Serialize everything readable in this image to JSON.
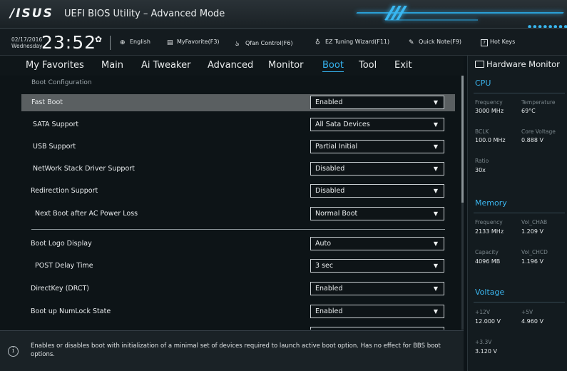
{
  "window": {
    "brand": "/ISUS",
    "title": "UEFI BIOS Utility – Advanced Mode"
  },
  "toolbar": {
    "date": "02/17/2016",
    "day": "Wednesday",
    "time": "23:52",
    "language": "English",
    "myfavorite": "MyFavorite(F3)",
    "qfan": "Qfan Control(F6)",
    "ez_tuning": "EZ Tuning Wizard(F11)",
    "quick_note": "Quick Note(F9)",
    "hot_keys": "Hot Keys"
  },
  "menu": {
    "items": [
      "My Favorites",
      "Main",
      "Ai Tweaker",
      "Advanced",
      "Monitor",
      "Boot",
      "Tool",
      "Exit"
    ],
    "active": "Boot"
  },
  "content": {
    "section": "Boot Configuration",
    "rows": [
      {
        "label": "Fast Boot",
        "value": "Enabled"
      },
      {
        "label": "SATA Support",
        "value": "All Sata Devices"
      },
      {
        "label": "USB Support",
        "value": "Partial Initial"
      },
      {
        "label": "NetWork Stack Driver Support",
        "value": "Disabled"
      },
      {
        "label": "Redirection Support",
        "value": "Disabled"
      },
      {
        "label": "Next Boot after AC Power Loss",
        "value": "Normal Boot"
      },
      {
        "label": "Boot Logo Display",
        "value": "Auto"
      },
      {
        "label": "POST Delay Time",
        "value": "3 sec"
      },
      {
        "label": "DirectKey (DRCT)",
        "value": "Enabled"
      },
      {
        "label": "Boot up NumLock State",
        "value": "Enabled"
      }
    ]
  },
  "help": {
    "text": "Enables or disables boot with initialization of a minimal set of devices required to launch active boot option. Has no effect for BBS boot options."
  },
  "hardware_monitor": {
    "title": "Hardware Monitor",
    "cpu": {
      "heading": "CPU",
      "frequency_label": "Frequency",
      "frequency": "3000 MHz",
      "temperature_label": "Temperature",
      "temperature": "69°C",
      "bclk_label": "BCLK",
      "bclk": "100.0 MHz",
      "core_voltage_label": "Core Voltage",
      "core_voltage": "0.888 V",
      "ratio_label": "Ratio",
      "ratio": "30x"
    },
    "memory": {
      "heading": "Memory",
      "frequency_label": "Frequency",
      "frequency": "2133 MHz",
      "vol_chab_label": "Vol_CHAB",
      "vol_chab": "1.209 V",
      "capacity_label": "Capacity",
      "capacity": "4096 MB",
      "vol_chcd_label": "Vol_CHCD",
      "vol_chcd": "1.196 V"
    },
    "voltage": {
      "heading": "Voltage",
      "v12_label": "+12V",
      "v12": "12.000 V",
      "v5_label": "+5V",
      "v5": "4.960 V",
      "v33_label": "+3.3V",
      "v33": "3.120 V"
    }
  }
}
